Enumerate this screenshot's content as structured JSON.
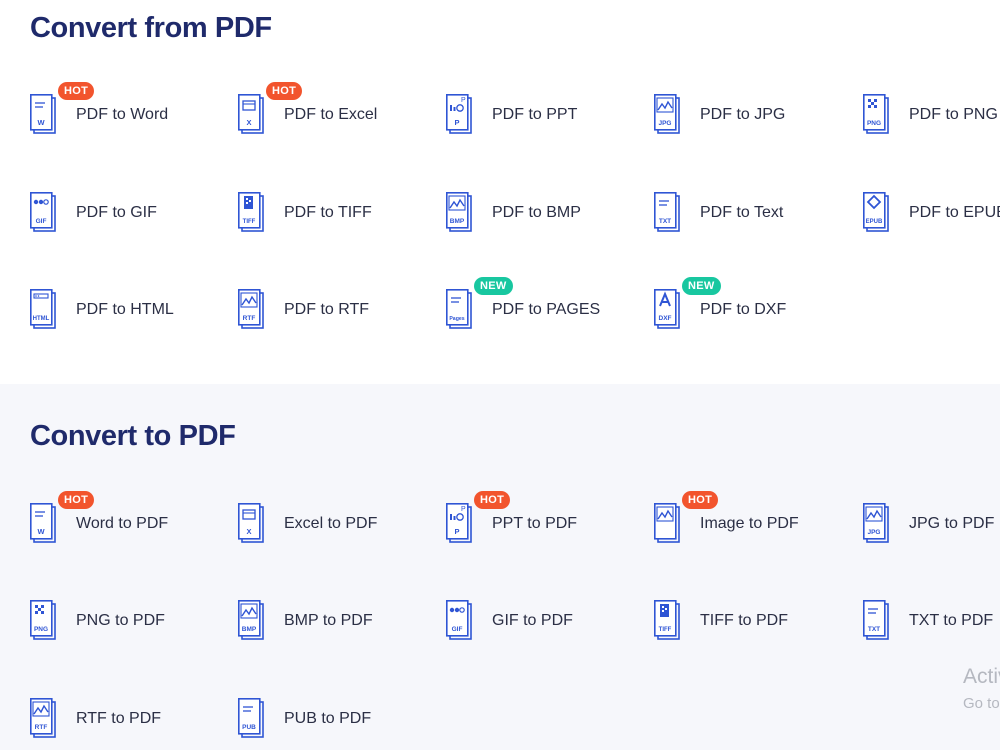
{
  "colors": {
    "title": "#1f2a6b",
    "icon": "#2f55d4",
    "hot_badge": "#f2542d",
    "new_badge": "#18c7a0",
    "alt_background": "#f6f7fb"
  },
  "convert_from": {
    "title": "Convert from PDF",
    "tools": [
      {
        "label": "PDF to Word",
        "tag": "W",
        "icon": "word-file-icon",
        "badge": "HOT"
      },
      {
        "label": "PDF to Excel",
        "tag": "X",
        "icon": "excel-file-icon",
        "badge": "HOT"
      },
      {
        "label": "PDF to PPT",
        "tag": "P",
        "icon": "ppt-file-icon",
        "badge": ""
      },
      {
        "label": "PDF to JPG",
        "tag": "JPG",
        "icon": "jpg-file-icon",
        "badge": ""
      },
      {
        "label": "PDF to PNG",
        "tag": "PNG",
        "icon": "png-file-icon",
        "badge": ""
      },
      {
        "label": "PDF to GIF",
        "tag": "GIF",
        "icon": "gif-file-icon",
        "badge": ""
      },
      {
        "label": "PDF to TIFF",
        "tag": "TIFF",
        "icon": "tiff-file-icon",
        "badge": ""
      },
      {
        "label": "PDF to BMP",
        "tag": "BMP",
        "icon": "bmp-file-icon",
        "badge": ""
      },
      {
        "label": "PDF to Text",
        "tag": "TXT",
        "icon": "txt-file-icon",
        "badge": ""
      },
      {
        "label": "PDF to EPUB",
        "tag": "EPUB",
        "icon": "epub-file-icon",
        "badge": ""
      },
      {
        "label": "PDF to HTML",
        "tag": "HTML",
        "icon": "html-file-icon",
        "badge": ""
      },
      {
        "label": "PDF to RTF",
        "tag": "RTF",
        "icon": "rtf-file-icon",
        "badge": ""
      },
      {
        "label": "PDF to PAGES",
        "tag": "Pages",
        "icon": "pages-file-icon",
        "badge": "NEW"
      },
      {
        "label": "PDF to DXF",
        "tag": "DXF",
        "icon": "dxf-file-icon",
        "badge": "NEW"
      }
    ]
  },
  "convert_to": {
    "title": "Convert to PDF",
    "tools": [
      {
        "label": "Word to PDF",
        "tag": "W",
        "icon": "word-file-icon",
        "badge": "HOT"
      },
      {
        "label": "Excel to PDF",
        "tag": "X",
        "icon": "excel-file-icon",
        "badge": ""
      },
      {
        "label": "PPT to PDF",
        "tag": "P",
        "icon": "ppt-file-icon",
        "badge": "HOT"
      },
      {
        "label": "Image to PDF",
        "tag": "",
        "icon": "image-file-icon",
        "badge": "HOT"
      },
      {
        "label": "JPG to PDF",
        "tag": "JPG",
        "icon": "jpg-file-icon",
        "badge": ""
      },
      {
        "label": "PNG to PDF",
        "tag": "PNG",
        "icon": "png-file-icon",
        "badge": ""
      },
      {
        "label": "BMP to PDF",
        "tag": "BMP",
        "icon": "bmp-file-icon",
        "badge": ""
      },
      {
        "label": "GIF to PDF",
        "tag": "GIF",
        "icon": "gif-file-icon",
        "badge": ""
      },
      {
        "label": "TIFF to PDF",
        "tag": "TIFF",
        "icon": "tiff-file-icon",
        "badge": ""
      },
      {
        "label": "TXT to PDF",
        "tag": "TXT",
        "icon": "txt-file-icon",
        "badge": ""
      },
      {
        "label": "RTF to PDF",
        "tag": "RTF",
        "icon": "rtf-file-icon",
        "badge": ""
      },
      {
        "label": "PUB to PDF",
        "tag": "PUB",
        "icon": "pub-file-icon",
        "badge": ""
      }
    ]
  },
  "watermark": {
    "line1": "Activ",
    "line2": "Go to"
  }
}
